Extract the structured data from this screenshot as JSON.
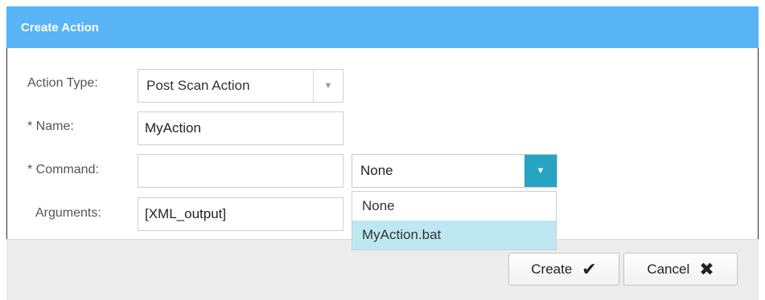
{
  "dialog": {
    "title": "Create Action"
  },
  "form": {
    "action_type_label": "Action Type:",
    "action_type_value": "Post Scan Action",
    "name_label": "* Name:",
    "name_value": "MyAction",
    "command_label": "* Command:",
    "command_value": "",
    "command_select_value": "None",
    "command_options": [
      "None",
      "MyAction.bat"
    ],
    "arguments_label": "Arguments:",
    "arguments_value": "[XML_output]"
  },
  "buttons": {
    "create_label": "Create",
    "cancel_label": "Cancel"
  },
  "colors": {
    "header": "#58b4f5",
    "dropdown_arrow": "#27a4c3",
    "option_highlight": "#bde8f1"
  },
  "icons": {
    "select_arrow": "triangle-down",
    "create": "checkmark-icon",
    "cancel": "x-icon"
  }
}
